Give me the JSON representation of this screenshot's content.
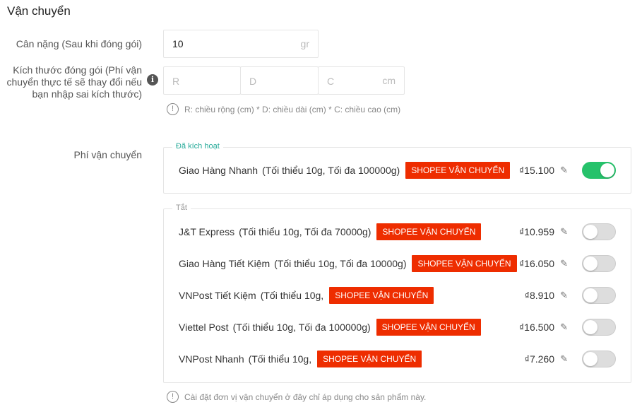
{
  "section_title": "Vận chuyển",
  "weight": {
    "label": "Cân nặng (Sau khi đóng gói)",
    "value": "10",
    "unit": "gr"
  },
  "size": {
    "label": "Kích thước đóng gói (Phí vận chuyển thực tế sẽ thay đổi nếu bạn nhập sai kích thước)",
    "r_placeholder": "R",
    "d_placeholder": "D",
    "c_placeholder": "C",
    "unit": "cm",
    "hint": "R: chiều rộng (cm) * D: chiều dài (cm) * C: chiều cao (cm)"
  },
  "fee": {
    "label": "Phí vận chuyển",
    "active_legend": "Đã kích hoạt",
    "off_legend": "Tắt",
    "badge": "SHOPEE VẬN CHUYỂN",
    "active": [
      {
        "name": "Giao Hàng Nhanh",
        "limit": "(Tối thiểu 10g, Tối đa 100000g)",
        "price": "₫15.100",
        "enabled": true
      }
    ],
    "off": [
      {
        "name": "J&T Express",
        "limit": "(Tối thiểu 10g, Tối đa 70000g)",
        "price": "₫10.959",
        "enabled": false
      },
      {
        "name": "Giao Hàng Tiết Kiệm",
        "limit": "(Tối thiểu 10g, Tối đa 10000g)",
        "price": "₫16.050",
        "enabled": false
      },
      {
        "name": "VNPost Tiết Kiệm",
        "limit": "(Tối thiểu 10g,",
        "price": "₫8.910",
        "enabled": false
      },
      {
        "name": "Viettel Post",
        "limit": "(Tối thiểu 10g, Tối đa 100000g)",
        "price": "₫16.500",
        "enabled": false
      },
      {
        "name": "VNPost Nhanh",
        "limit": "(Tối thiểu 10g,",
        "price": "₫7.260",
        "enabled": false
      }
    ]
  },
  "footer_hint": "Cài đặt đơn vị vận chuyển ở đây chỉ áp dụng cho sản phẩm này.",
  "colors": {
    "badge": "#ee2d00",
    "toggle_on": "#26c26b",
    "active_legend": "#26aa99"
  }
}
